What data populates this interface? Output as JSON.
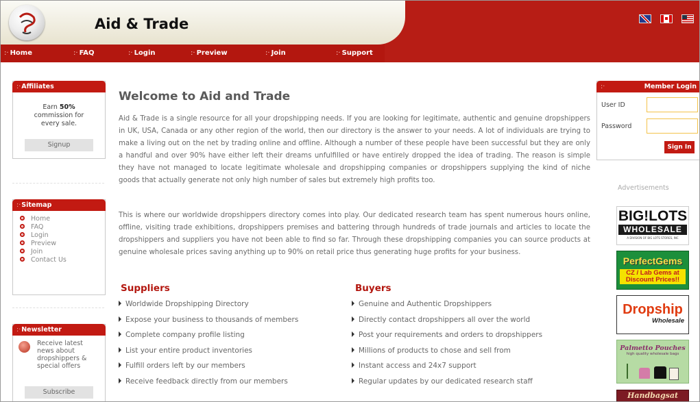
{
  "header": {
    "site_title": "Aid & Trade"
  },
  "nav": {
    "items": [
      "Home",
      "FAQ",
      "Login",
      "Preview",
      "Join",
      "Support"
    ]
  },
  "affiliates": {
    "title": "Affiliates",
    "line1_prefix": "Earn ",
    "line1_bold": "50%",
    "line2": "commission for",
    "line3": "every sale.",
    "button": "Signup"
  },
  "sitemap": {
    "title": "Sitemap",
    "items": [
      "Home",
      "FAQ",
      "Login",
      "Preview",
      "Join",
      "Contact Us"
    ]
  },
  "newsletter": {
    "title": "Newsletter",
    "text": "Receive latest news about dropshippers & special offers",
    "button": "Subscribe"
  },
  "main": {
    "title": "Welcome to Aid and Trade",
    "para1": "Aid & Trade is a single resource for all your dropshipping needs. If you are looking for legitimate, authentic and genuine dropshippers in UK, USA, Canada or any other region of the world, then our directory is the answer to your needs. A lot of individuals are trying to make a living out on the net by trading online and offline. Although a number of these people have been successful but they are only a handful and over 90% have either left their dreams unfulfilled or have entirely dropped the idea of trading. The reason is simple they have not managed to locate legitimate wholesale and dropshipping companies or dropshippers supplying the kind of niche goods that actually generate not only high number of sales but extremely high profits too.",
    "para2": "This is where our worldwide dropshippers directory comes into play. Our dedicated research team has spent numerous hours online, offline, visiting trade exhibitions, dropshippers premises and battering through hundreds of trade journals and articles to locate the dropshippers and suppliers you have not been able to find so far. Through these dropshipping companies you can source products at genuine wholesale prices saving anything up to 90% on retail price thus generating huge profits for your business.",
    "suppliers": {
      "title": "Suppliers",
      "items": [
        "Worldwide Dropshipping Directory",
        "Expose your business to thousands of members",
        "Complete company profile listing",
        "List your entire product inventories",
        "Fulfill orders left by our members",
        "Receive feedback directly from our members"
      ]
    },
    "buyers": {
      "title": "Buyers",
      "items": [
        "Genuine and Authentic Dropshippers",
        "Directly contact dropshippers all over the world",
        "Post your requirements and orders to dropshippers",
        "Millions of products to chose and sell from",
        "Instant access and 24x7 support",
        "Regular updates by our dedicated research staff"
      ]
    }
  },
  "login": {
    "title": "Member Login",
    "user_label": "User ID",
    "pass_label": "Password",
    "button": "Sign In"
  },
  "ads": {
    "label": "Advertisements",
    "biglots_line1": "BIG!LOTS",
    "biglots_line2": "WHOLESALE",
    "biglots_line3": "A DIVISION OF BIG LOTS STORES, INC",
    "perfect_line1": "PerfectGems",
    "perfect_line2": "CZ / Lab Gems at",
    "perfect_line3": "Discount Prices!!",
    "dropship_line1": "Dropship",
    "dropship_line2": "Wholesale",
    "palmetto_line1": "Palmetto Pouches",
    "palmetto_line2": "high quality wholesale bags",
    "handbag_line1": "Handbagsat"
  },
  "colors": {
    "brand_red": "#b71d15",
    "input_border": "#f3c24a"
  }
}
